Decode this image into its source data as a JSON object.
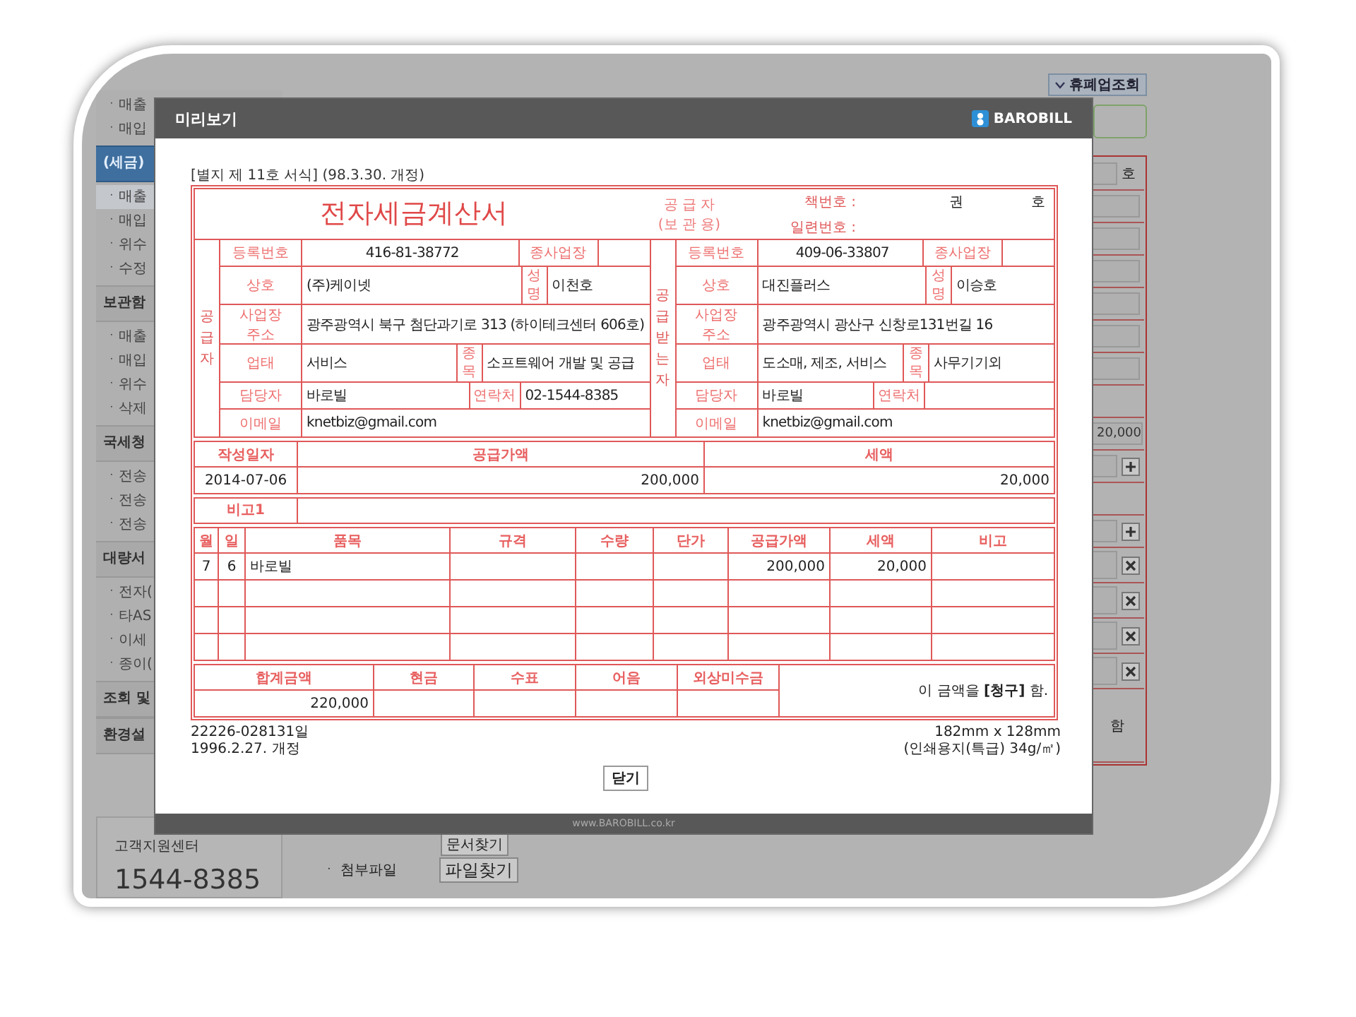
{
  "sidebar": {
    "groups": [
      {
        "items": [
          {
            "label": "ㆍ매출",
            "selected": false
          },
          {
            "label": "ㆍ매입",
            "selected": false
          }
        ]
      },
      {
        "title": "(세금)",
        "active": true,
        "items": [
          {
            "label": "ㆍ매출",
            "selected": true
          },
          {
            "label": "ㆍ매입",
            "selected": false
          },
          {
            "label": "ㆍ위수",
            "selected": false
          },
          {
            "label": "ㆍ수정",
            "selected": false
          }
        ]
      },
      {
        "title": "보관함",
        "active": false,
        "items": [
          {
            "label": "ㆍ매출",
            "selected": false
          },
          {
            "label": "ㆍ매입",
            "selected": false
          },
          {
            "label": "ㆍ위수",
            "selected": false
          },
          {
            "label": "ㆍ삭제",
            "selected": false
          }
        ]
      },
      {
        "title": "국세청",
        "active": false,
        "items": [
          {
            "label": "ㆍ전송",
            "selected": false
          },
          {
            "label": "ㆍ전송",
            "selected": false
          },
          {
            "label": "ㆍ전송",
            "selected": false
          }
        ]
      },
      {
        "title": "대량서",
        "active": false,
        "items": [
          {
            "label": "ㆍ전자(",
            "selected": false
          },
          {
            "label": "ㆍ타AS",
            "selected": false
          },
          {
            "label": "ㆍ이세",
            "selected": false
          },
          {
            "label": "ㆍ종이(",
            "selected": false
          }
        ]
      },
      {
        "title": "조회 및",
        "active": false
      },
      {
        "title": "환경설",
        "active": false
      }
    ],
    "support": {
      "label": "고객지원센터",
      "phone": "1544-8385"
    }
  },
  "toolbar": {
    "lookup_button": "휴폐업조회"
  },
  "form_column": [
    {
      "kind": "suffix",
      "text": "호"
    },
    {
      "kind": "field"
    },
    {
      "kind": "field"
    },
    {
      "kind": "field"
    },
    {
      "kind": "field"
    },
    {
      "kind": "field"
    },
    {
      "kind": "field"
    },
    {
      "kind": "band"
    },
    {
      "kind": "value",
      "text": "20,000"
    },
    {
      "kind": "add"
    },
    {
      "kind": "band"
    },
    {
      "kind": "add"
    },
    {
      "kind": "remove"
    },
    {
      "kind": "remove"
    },
    {
      "kind": "remove"
    },
    {
      "kind": "remove"
    },
    {
      "kind": "text",
      "text": "함"
    }
  ],
  "attachments": {
    "find_doc_button": "문서찾기",
    "label": "ㆍ 첨부파일",
    "find_file_button": "파일찾기"
  },
  "modal": {
    "title": "미리보기",
    "brand": "BAROBILL",
    "footer": "www.BAROBILL.co.kr",
    "form_note": "[별지 제 11호 서식] (98.3.30. 개정)",
    "invoice": {
      "title": "전자세금계산서",
      "copy_label": "공 급 자",
      "copy_sub": "(보 관 용)",
      "book_label": "책번호 :",
      "book_vol": "권",
      "book_no": "호",
      "serial_label": "일련번호 :",
      "parties": [
        {
          "side_label": "공급자",
          "rows": [
            [
              {
                "kind": "label",
                "text": "등록번호"
              },
              {
                "kind": "value",
                "text": "416-81-38772"
              },
              {
                "kind": "label",
                "text": "종사업장"
              },
              {
                "kind": "blank"
              }
            ],
            [
              {
                "kind": "label",
                "text": "상호"
              },
              {
                "kind": "value",
                "text": "(주)케이넷"
              },
              {
                "kind": "label",
                "text": "성명"
              },
              {
                "kind": "value",
                "text": "이천호"
              }
            ],
            [
              {
                "kind": "label",
                "text": "사업장 주소"
              },
              {
                "kind": "value",
                "text": "광주광역시 북구 첨단과기로 313 (하이테크센터 606호)"
              }
            ],
            [
              {
                "kind": "label",
                "text": "업태"
              },
              {
                "kind": "value",
                "text": "서비스"
              },
              {
                "kind": "label",
                "text": "종목"
              },
              {
                "kind": "value",
                "text": "소프트웨어 개발 및 공급"
              }
            ],
            [
              {
                "kind": "label",
                "text": "담당자"
              },
              {
                "kind": "value",
                "text": "바로빌"
              },
              {
                "kind": "label",
                "text": "연락처"
              },
              {
                "kind": "value",
                "text": "02-1544-8385"
              }
            ],
            [
              {
                "kind": "label",
                "text": "이메일"
              },
              {
                "kind": "value",
                "text": "knetbiz@gmail.com"
              }
            ]
          ]
        },
        {
          "side_label": "공급받는자",
          "rows": [
            [
              {
                "kind": "label",
                "text": "등록번호"
              },
              {
                "kind": "value",
                "text": "409-06-33807"
              },
              {
                "kind": "label",
                "text": "종사업장"
              },
              {
                "kind": "blank"
              }
            ],
            [
              {
                "kind": "label",
                "text": "상호"
              },
              {
                "kind": "value",
                "text": "대진플러스"
              },
              {
                "kind": "label",
                "text": "성명"
              },
              {
                "kind": "value",
                "text": "이승호"
              }
            ],
            [
              {
                "kind": "label",
                "text": "사업장 주소"
              },
              {
                "kind": "value",
                "text": "광주광역시 광산구 신창로131번길 16"
              }
            ],
            [
              {
                "kind": "label",
                "text": "업태"
              },
              {
                "kind": "value",
                "text": "도소매, 제조, 서비스"
              },
              {
                "kind": "label",
                "text": "종목"
              },
              {
                "kind": "value",
                "text": "사무기기외"
              }
            ],
            [
              {
                "kind": "label",
                "text": "담당자"
              },
              {
                "kind": "value",
                "text": "바로빌"
              },
              {
                "kind": "label",
                "text": "연락처"
              },
              {
                "kind": "blank"
              }
            ],
            [
              {
                "kind": "label",
                "text": "이메일"
              },
              {
                "kind": "value",
                "text": "knetbiz@gmail.com"
              }
            ]
          ]
        }
      ],
      "summary": {
        "columns": [
          "작성일자",
          "공급가액",
          "세액"
        ],
        "values": [
          "2014-07-06",
          "200,000",
          "20,000"
        ]
      },
      "remark_label": "비고1",
      "items": {
        "columns": [
          "월",
          "일",
          "품목",
          "규격",
          "수량",
          "단가",
          "공급가액",
          "세액",
          "비고"
        ],
        "rows": [
          {
            "kind": "entry",
            "month": "7",
            "day": "6",
            "name": "바로빌",
            "supply_amount": "200,000",
            "tax": "20,000"
          },
          {
            "kind": "blank"
          },
          {
            "kind": "blank"
          },
          {
            "kind": "blank"
          }
        ]
      },
      "totals": {
        "columns": [
          "합계금액",
          "현금",
          "수표",
          "어음",
          "외상미수금"
        ],
        "total": "220,000",
        "statement": "이 금액을 **[청구]** 함."
      }
    },
    "footnotes_left": [
      "22226-028131일",
      "1996.2.27. 개정"
    ],
    "footnotes_right": [
      "182mm x 128mm",
      "(인쇄용지(특급) 34g/㎡)"
    ],
    "close_button": "닫기"
  }
}
